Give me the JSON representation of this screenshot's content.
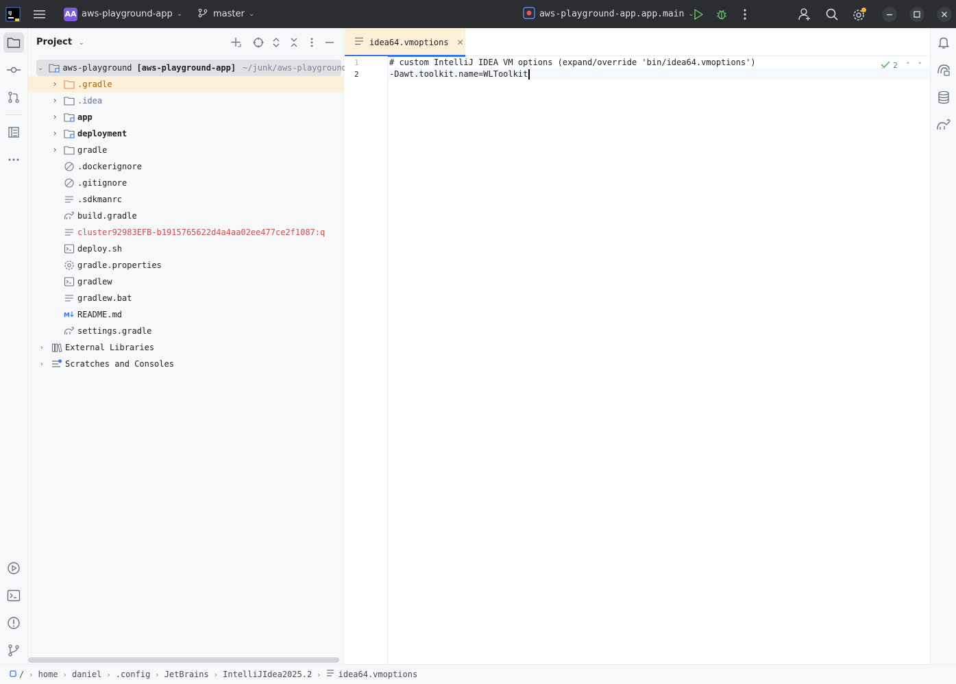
{
  "titlebar": {
    "project_badge": "AA",
    "project_name": "aws-playground-app",
    "branch": "master",
    "run_config": "aws-playground-app.app.main"
  },
  "project_panel": {
    "title": "Project",
    "root": {
      "name": "aws-playground",
      "module": "[aws-playground-app]",
      "path": "~/junk/aws-playground"
    },
    "items": [
      {
        "label": ".gradle",
        "type": "folder",
        "style": "orange"
      },
      {
        "label": ".idea",
        "type": "folder",
        "style": "dimmed"
      },
      {
        "label": "app",
        "type": "module",
        "style": "bold"
      },
      {
        "label": "deployment",
        "type": "module",
        "style": "bold"
      },
      {
        "label": "gradle",
        "type": "folder",
        "style": "normal"
      },
      {
        "label": ".dockerignore",
        "type": "ignore",
        "style": "normal"
      },
      {
        "label": ".gitignore",
        "type": "ignore",
        "style": "normal"
      },
      {
        "label": ".sdkmanrc",
        "type": "text",
        "style": "normal"
      },
      {
        "label": "build.gradle",
        "type": "gradle",
        "style": "normal"
      },
      {
        "label": "cluster92983EFB-b1915765622d4a4aa02ee477ce2f1087:q",
        "type": "text",
        "style": "red"
      },
      {
        "label": "deploy.sh",
        "type": "shell",
        "style": "normal"
      },
      {
        "label": "gradle.properties",
        "type": "settings",
        "style": "normal"
      },
      {
        "label": "gradlew",
        "type": "shell",
        "style": "normal"
      },
      {
        "label": "gradlew.bat",
        "type": "text",
        "style": "normal"
      },
      {
        "label": "README.md",
        "type": "markdown",
        "style": "normal"
      },
      {
        "label": "settings.gradle",
        "type": "gradle",
        "style": "normal"
      }
    ],
    "external_libraries": "External Libraries",
    "scratches": "Scratches and Consoles"
  },
  "editor": {
    "tab": "idea64.vmoptions",
    "lines": [
      {
        "no": "1",
        "text": "# custom IntelliJ IDEA VM options (expand/override 'bin/idea64.vmoptions')"
      },
      {
        "no": "2",
        "text": "-Dawt.toolkit.name=WLToolkit"
      }
    ],
    "inspection_count": "2"
  },
  "breadcrumbs": [
    "/",
    "home",
    "daniel",
    ".config",
    "JetBrains",
    "IntelliJIdea2025.2",
    "idea64.vmoptions"
  ],
  "colors": {
    "accent": "#3574f0",
    "selection": "#fcf0d8",
    "titlebar": "#2b2d30",
    "run_green": "#5fb865",
    "notification": "#f2b53a"
  }
}
